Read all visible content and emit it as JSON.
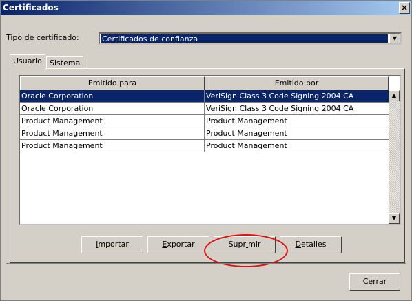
{
  "window": {
    "title": "Certificados",
    "close_glyph": "×"
  },
  "cert_type": {
    "label": "Tipo de certificado:",
    "value": "Certificados de confianza"
  },
  "tabs": [
    "Usuario",
    "Sistema"
  ],
  "table": {
    "columns": [
      "Emitido para",
      "Emitido por"
    ],
    "rows": [
      {
        "issued_to": "Oracle Corporation",
        "issued_by": "VeriSign Class 3 Code Signing 2004 CA",
        "selected": true
      },
      {
        "issued_to": "Oracle Corporation",
        "issued_by": "VeriSign Class 3 Code Signing 2004 CA",
        "selected": false
      },
      {
        "issued_to": "Product Management",
        "issued_by": "Product Management",
        "selected": false
      },
      {
        "issued_to": "Product Management",
        "issued_by": "Product Management",
        "selected": false
      },
      {
        "issued_to": "Product Management",
        "issued_by": "Product Management",
        "selected": false
      }
    ]
  },
  "buttons": {
    "import": {
      "mnemonic": "I",
      "rest": "mportar"
    },
    "export": {
      "mnemonic": "E",
      "rest": "xportar"
    },
    "delete": {
      "pre": "Supr",
      "mnemonic": "i",
      "rest": "mir"
    },
    "details": {
      "mnemonic": "D",
      "rest": "etalles"
    },
    "close": "Cerrar"
  },
  "icons": {
    "dropdown": "chevron-down-icon",
    "scroll_up": "scroll-up-icon",
    "scroll_down": "scroll-down-icon"
  },
  "colors": {
    "selection": "#0a246a",
    "dialog_bg": "#d4d0c8",
    "annotation_ring": "#e01010"
  }
}
